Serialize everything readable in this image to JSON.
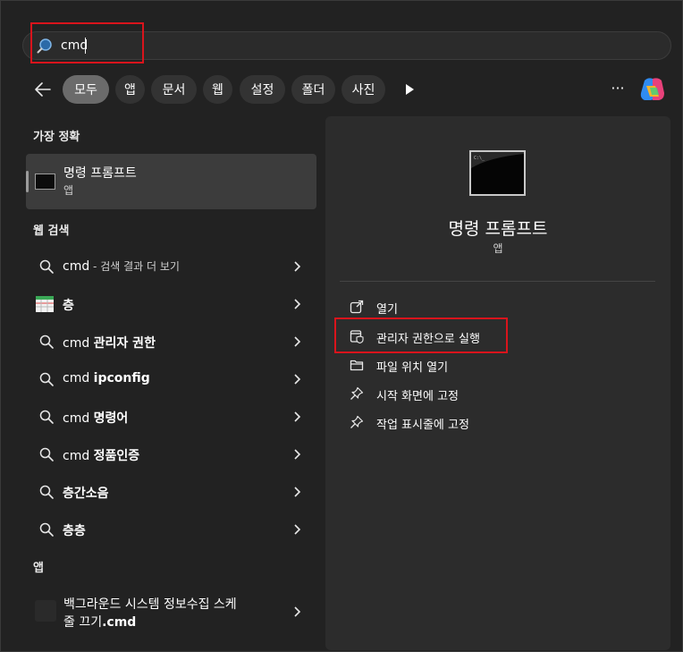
{
  "search": {
    "query": "cmd",
    "icon": "search-icon"
  },
  "filters": {
    "back_icon": "back-arrow-icon",
    "tabs": [
      {
        "label": "모두",
        "active": true
      },
      {
        "label": "앱"
      },
      {
        "label": "문서"
      },
      {
        "label": "웹"
      },
      {
        "label": "설정"
      },
      {
        "label": "폴더"
      },
      {
        "label": "사진"
      }
    ],
    "play_icon": "play-icon",
    "more_label": "···",
    "copilot_icon": "copilot-icon"
  },
  "best_match": {
    "heading": "가장 정확",
    "title": "명령 프롬프트",
    "subtitle": "앱"
  },
  "web_search": {
    "heading": "웹 검색",
    "items": [
      {
        "icon": "search-icon",
        "prefix": "cmd",
        "bold": "",
        "suffix": " - 검색 결과 더 보기"
      },
      {
        "icon": "spreadsheet-icon",
        "prefix": "",
        "bold": "층",
        "suffix": ""
      },
      {
        "icon": "search-icon",
        "prefix": "cmd ",
        "bold": "관리자 권한",
        "suffix": ""
      },
      {
        "icon": "search-icon",
        "prefix": "cmd ",
        "bold": "ipconfig",
        "suffix": ""
      },
      {
        "icon": "search-icon",
        "prefix": "cmd ",
        "bold": "명령어",
        "suffix": ""
      },
      {
        "icon": "search-icon",
        "prefix": "cmd ",
        "bold": "정품인증",
        "suffix": ""
      },
      {
        "icon": "search-icon",
        "prefix": "",
        "bold": "층간소음",
        "suffix": ""
      },
      {
        "icon": "search-icon",
        "prefix": "",
        "bold": "층층",
        "suffix": ""
      }
    ]
  },
  "apps": {
    "heading": "앱",
    "item_line1": "백그라운드 시스템 정보수집 스케",
    "item_line2_normal": "줄 끄기",
    "item_line2_bold": ".cmd"
  },
  "detail": {
    "title": "명령 프롬프트",
    "subtitle": "앱",
    "actions": [
      {
        "icon": "open-external-icon",
        "label": "열기"
      },
      {
        "icon": "admin-shield-icon",
        "label": "관리자 권한으로 실행"
      },
      {
        "icon": "folder-icon",
        "label": "파일 위치 열기"
      },
      {
        "icon": "pin-icon",
        "label": "시작 화면에 고정"
      },
      {
        "icon": "pin-icon",
        "label": "작업 표시줄에 고정"
      }
    ]
  },
  "colors": {
    "highlight": "#d9141c",
    "panel": "#2c2c2c",
    "background": "#222222"
  }
}
